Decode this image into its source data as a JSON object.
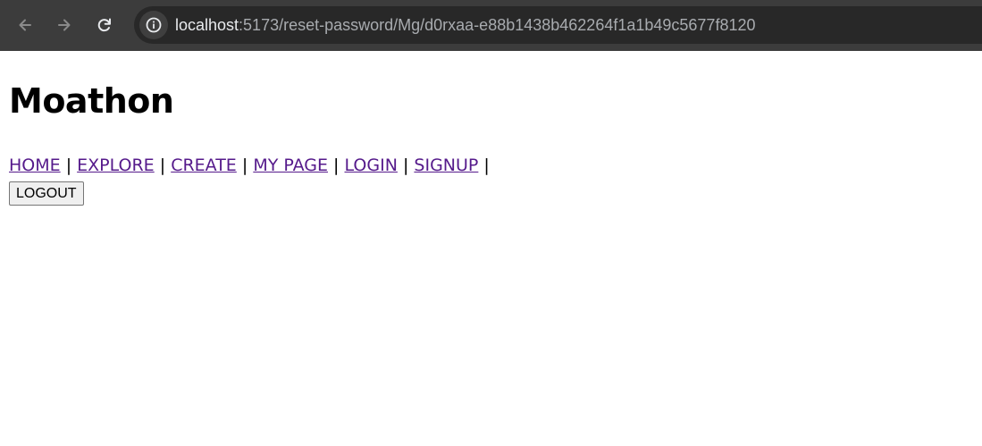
{
  "browser": {
    "url_host": "localhost",
    "url_path": ":5173/reset-password/Mg/d0rxaa-e88b1438b462264f1a1b49c5677f8120",
    "icons": {
      "back": "arrow-left-icon",
      "forward": "arrow-right-icon",
      "reload": "reload-icon",
      "site_info": "info-icon"
    },
    "colors": {
      "toolbar": "#3c3c3c",
      "omnibox": "#282828",
      "url_host": "#e8eaed",
      "url_path": "#a8abaf"
    }
  },
  "page": {
    "title": "Moathon",
    "nav": {
      "items": [
        {
          "label": "HOME"
        },
        {
          "label": "EXPLORE"
        },
        {
          "label": "CREATE"
        },
        {
          "label": "MY PAGE"
        },
        {
          "label": "LOGIN"
        },
        {
          "label": "SIGNUP"
        }
      ],
      "separator": "|"
    },
    "logout_label": "LOGOUT",
    "colors": {
      "link": "#551a8b",
      "text": "#000000"
    }
  }
}
